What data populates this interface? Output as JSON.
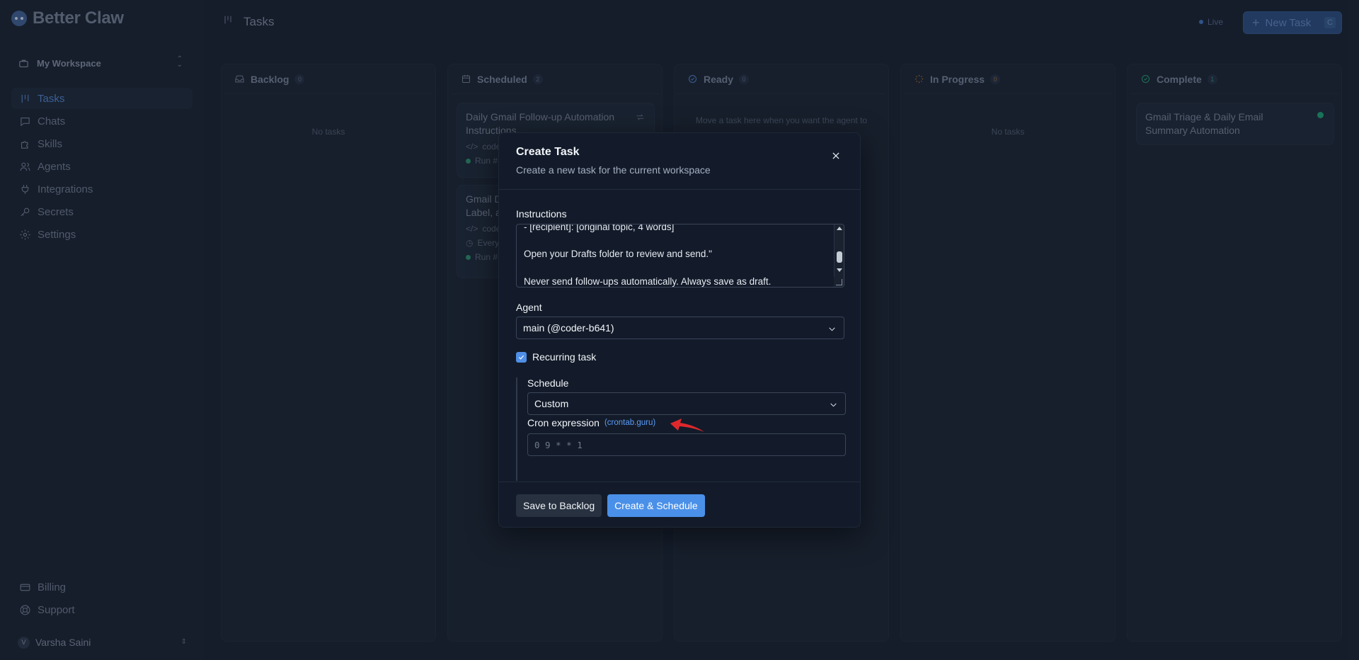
{
  "app": {
    "name": "Better Claw"
  },
  "workspace": {
    "name": "My Workspace"
  },
  "sidebar": {
    "items": [
      {
        "label": "Tasks",
        "icon": "kanban-icon",
        "active": true
      },
      {
        "label": "Chats",
        "icon": "chat-icon"
      },
      {
        "label": "Skills",
        "icon": "puzzle-icon"
      },
      {
        "label": "Agents",
        "icon": "users-icon"
      },
      {
        "label": "Integrations",
        "icon": "plug-icon"
      },
      {
        "label": "Secrets",
        "icon": "key-icon"
      },
      {
        "label": "Settings",
        "icon": "gear-icon"
      }
    ],
    "bottom_items": [
      {
        "label": "Billing",
        "icon": "card-icon"
      },
      {
        "label": "Support",
        "icon": "lifebuoy-icon"
      }
    ],
    "user": {
      "name": "Varsha Saini",
      "initial": "V"
    }
  },
  "header": {
    "title": "Tasks",
    "live_label": "Live",
    "new_task_label": "New Task",
    "new_task_shortcut": "C"
  },
  "board": {
    "columns": [
      {
        "title": "Backlog",
        "count": "0",
        "empty_text": "No tasks",
        "icon": "inbox-icon"
      },
      {
        "title": "Scheduled",
        "count": "2",
        "icon": "calendar-icon",
        "cards": [
          {
            "title": "Daily Gmail Follow-up Automation Instructions",
            "meta1": "code",
            "meta2": "Run #"
          },
          {
            "title": "Gmail D",
            "title2": "Label, a",
            "meta1": "code",
            "meta2": "Every",
            "meta3": "Run #"
          }
        ]
      },
      {
        "title": "Ready",
        "count": "0",
        "empty_text": "Move a task here when you want the agent to",
        "icon": "check-circle-icon"
      },
      {
        "title": "In Progress",
        "count": "0",
        "empty_text": "No tasks",
        "icon": "loader-icon"
      },
      {
        "title": "Complete",
        "count": "1",
        "icon": "check-done-icon",
        "cards": [
          {
            "title": "Gmail Triage & Daily Email Summary Automation"
          }
        ]
      }
    ]
  },
  "modal": {
    "title": "Create Task",
    "subtitle": "Create a new task for the current workspace",
    "instructions_label": "Instructions",
    "instructions_lines": [
      "- [recipient]: [original topic, 4 words]",
      "Open your Drafts folder to review and send.\"",
      "Never send follow-ups automatically. Always save as draft."
    ],
    "agent_label": "Agent",
    "agent_value": "main (@coder-b641)",
    "recurring_label": "Recurring task",
    "recurring_checked": true,
    "schedule_label": "Schedule",
    "schedule_value": "Custom",
    "cron_label": "Cron expression",
    "cron_link": "(crontab.guru)",
    "cron_placeholder": "0 9 * * 1",
    "save_backlog_label": "Save to Backlog",
    "create_schedule_label": "Create & Schedule"
  },
  "colors": {
    "accent": "#4a90e8",
    "link": "#5b9bf5",
    "annotation_arrow": "#e0282c",
    "complete_dot": "#1f9a72"
  }
}
